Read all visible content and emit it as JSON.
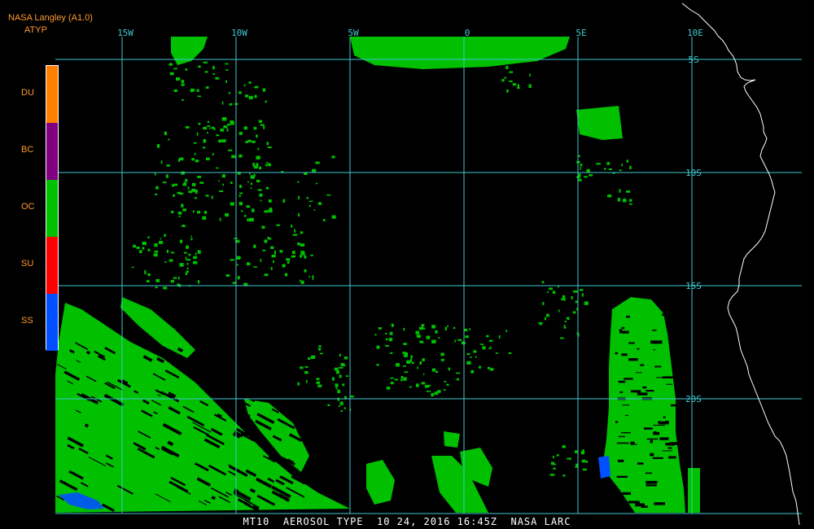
{
  "header": {
    "source": "NASA Langley (A1.0)",
    "product": "ATYP"
  },
  "legend": [
    {
      "code": "DU",
      "color": "#ff8000"
    },
    {
      "code": "BC",
      "color": "#800080"
    },
    {
      "code": "OC",
      "color": "#00c000"
    },
    {
      "code": "SU",
      "color": "#ff0000"
    },
    {
      "code": "SS",
      "color": "#0050ff"
    }
  ],
  "map": {
    "grid_color": "#40c8d0",
    "coast_color": "#ffffff",
    "lon_ticks": [
      {
        "label": "15W",
        "value": -15
      },
      {
        "label": "10W",
        "value": -10
      },
      {
        "label": "5W",
        "value": -5
      },
      {
        "label": "0",
        "value": 0
      },
      {
        "label": "5E",
        "value": 5
      },
      {
        "label": "10E",
        "value": 10
      }
    ],
    "lat_ticks": [
      {
        "label": "5S",
        "value": -5
      },
      {
        "label": "10S",
        "value": -10
      },
      {
        "label": "15S",
        "value": -15
      },
      {
        "label": "20S",
        "value": -20
      }
    ]
  },
  "footer": {
    "text": "MT10  AEROSOL TYPE  10 24, 2016 16:45Z  NASA LARC"
  }
}
